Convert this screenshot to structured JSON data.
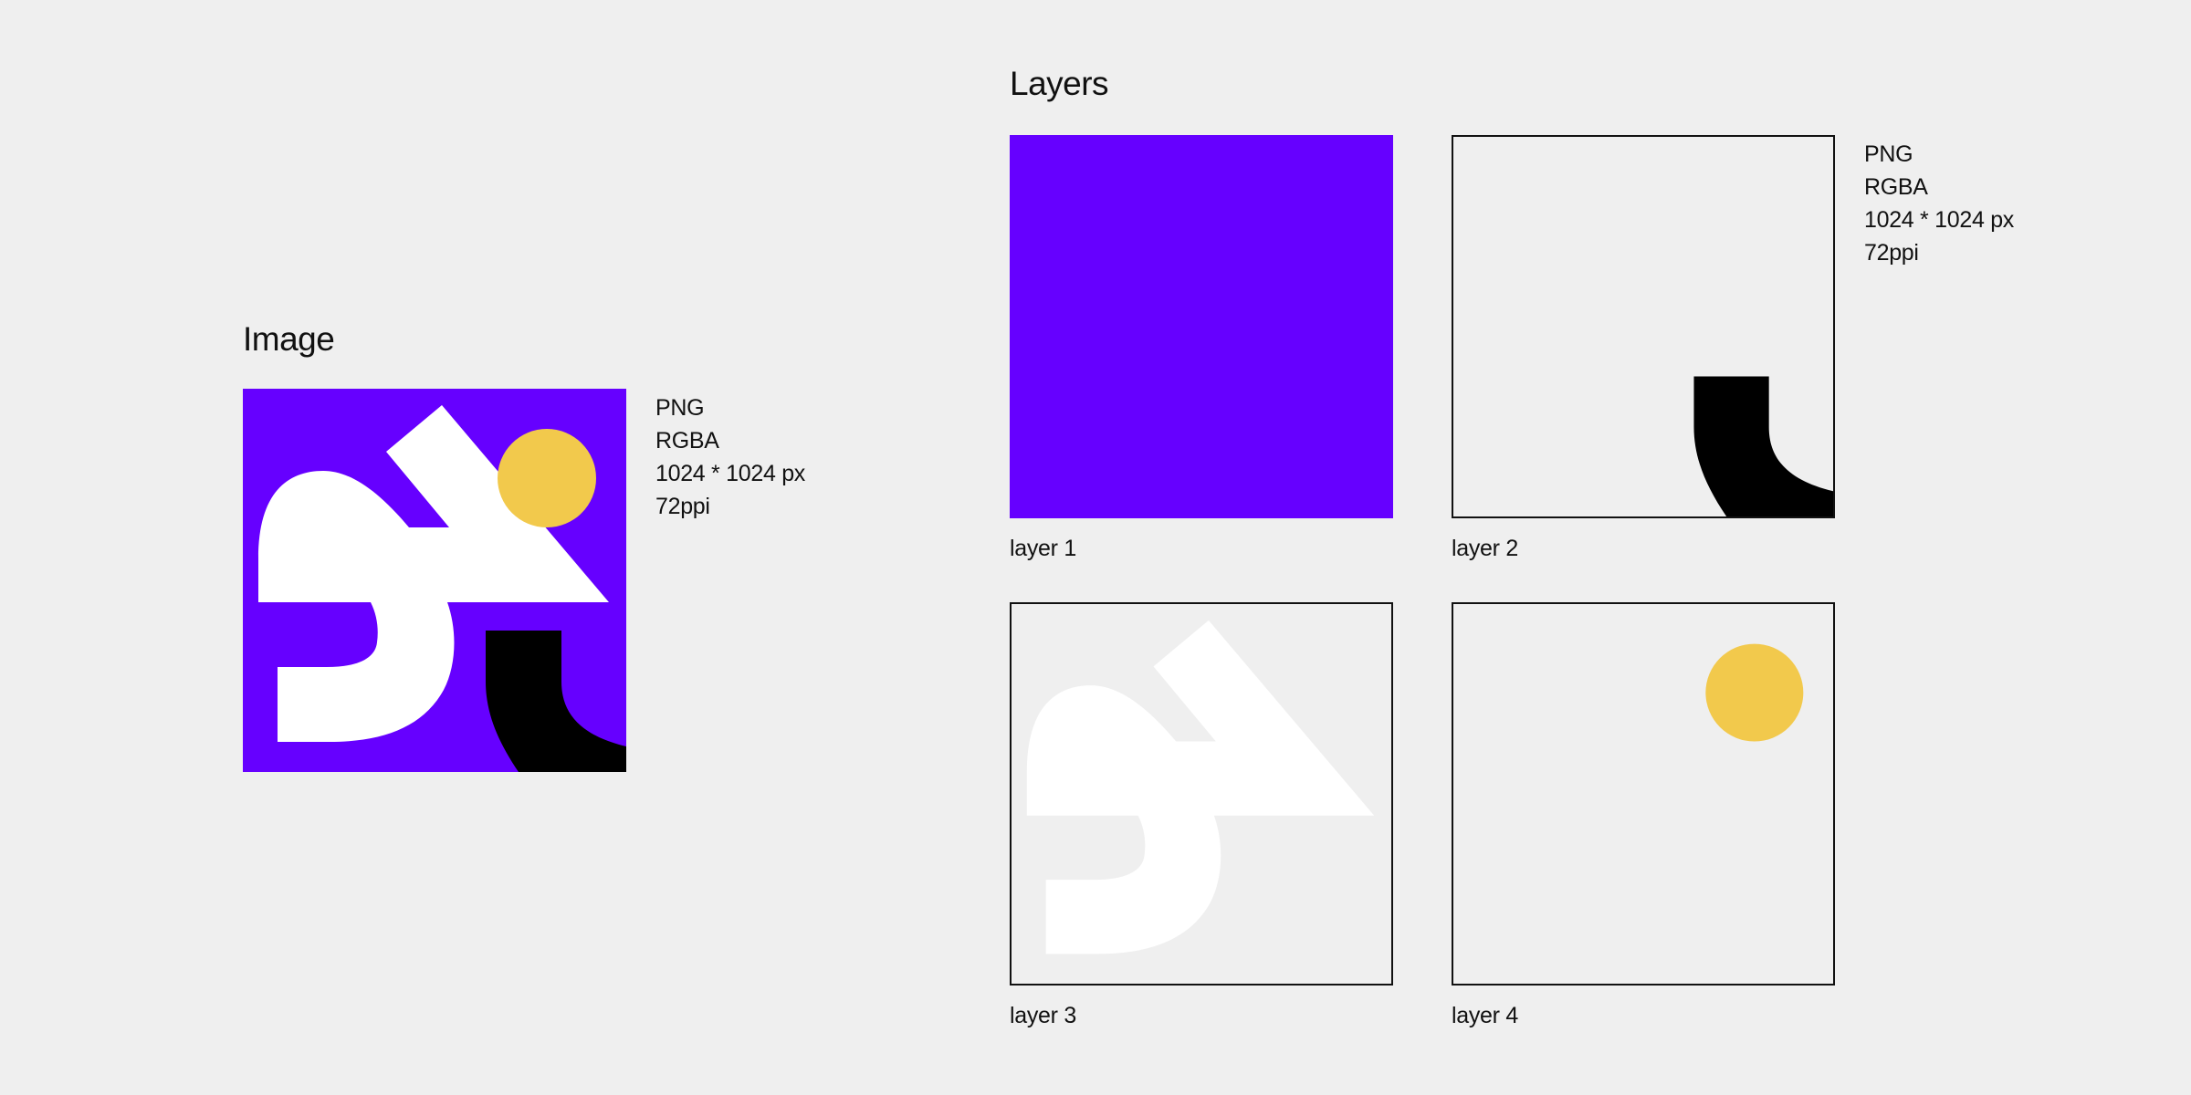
{
  "colors": {
    "background": "#efefef",
    "purple": "#6600ff",
    "white": "#ffffff",
    "black": "#000000",
    "yellow": "#f2c94c",
    "outline": "#111111"
  },
  "image_section": {
    "title": "Image",
    "meta": [
      "PNG",
      "RGBA",
      "1024 * 1024 px",
      "72ppi"
    ]
  },
  "layers_section": {
    "title": "Layers",
    "meta": [
      "PNG",
      "RGBA",
      "1024 * 1024 px",
      "72ppi"
    ],
    "layers": [
      {
        "label": "layer 1",
        "content": "purple-fill"
      },
      {
        "label": "layer 2",
        "content": "black-curve"
      },
      {
        "label": "layer 3",
        "content": "white-glyph"
      },
      {
        "label": "layer 4",
        "content": "yellow-circle"
      }
    ]
  }
}
